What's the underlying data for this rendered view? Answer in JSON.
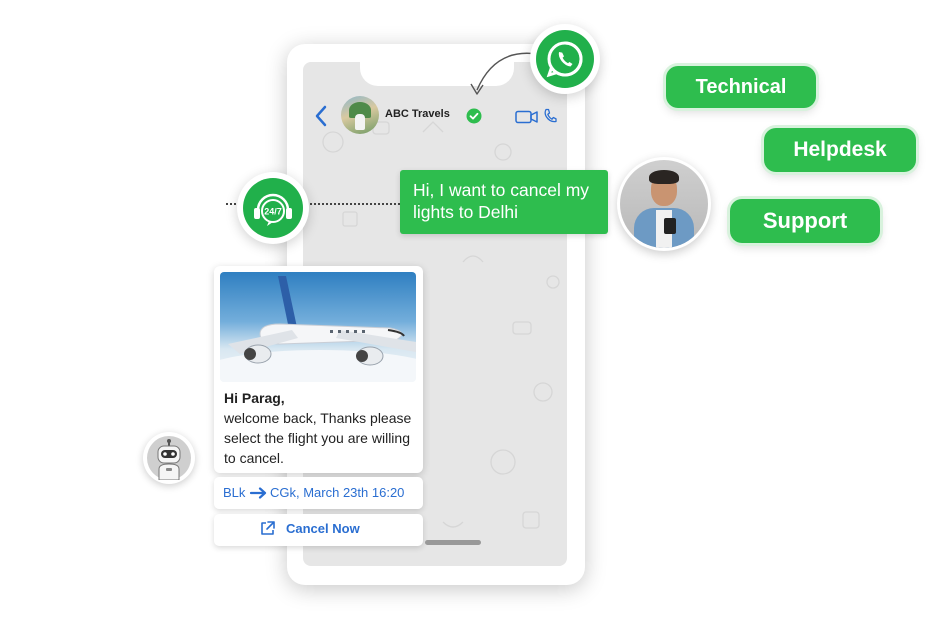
{
  "chat": {
    "contact_name": "ABC Travels",
    "outgoing_message": "Hi, I want to cancel my lights to Delhi"
  },
  "pills": {
    "technical": "Technical",
    "helpdesk": "Helpdesk",
    "support": "Support"
  },
  "support_badge": {
    "label": "24/7"
  },
  "card": {
    "greeting": "Hi Parag,",
    "body": "welcome back, Thanks please select the flight you are willing to cancel.",
    "route_from": "BLk",
    "route_to": "CGk, March 23th 16:20",
    "cancel_label": "Cancel Now"
  },
  "icons": {
    "back": "chevron-left-icon",
    "verified": "verified-check-icon",
    "video": "video-camera-icon",
    "call": "phone-icon",
    "whatsapp": "whatsapp-icon",
    "support": "headset-24-7-icon",
    "external": "external-link-icon",
    "bot": "robot-icon"
  },
  "colors": {
    "brand_green": "#2ebd4e",
    "whatsapp_green": "#21b04b",
    "link_blue": "#2a6ed1"
  }
}
